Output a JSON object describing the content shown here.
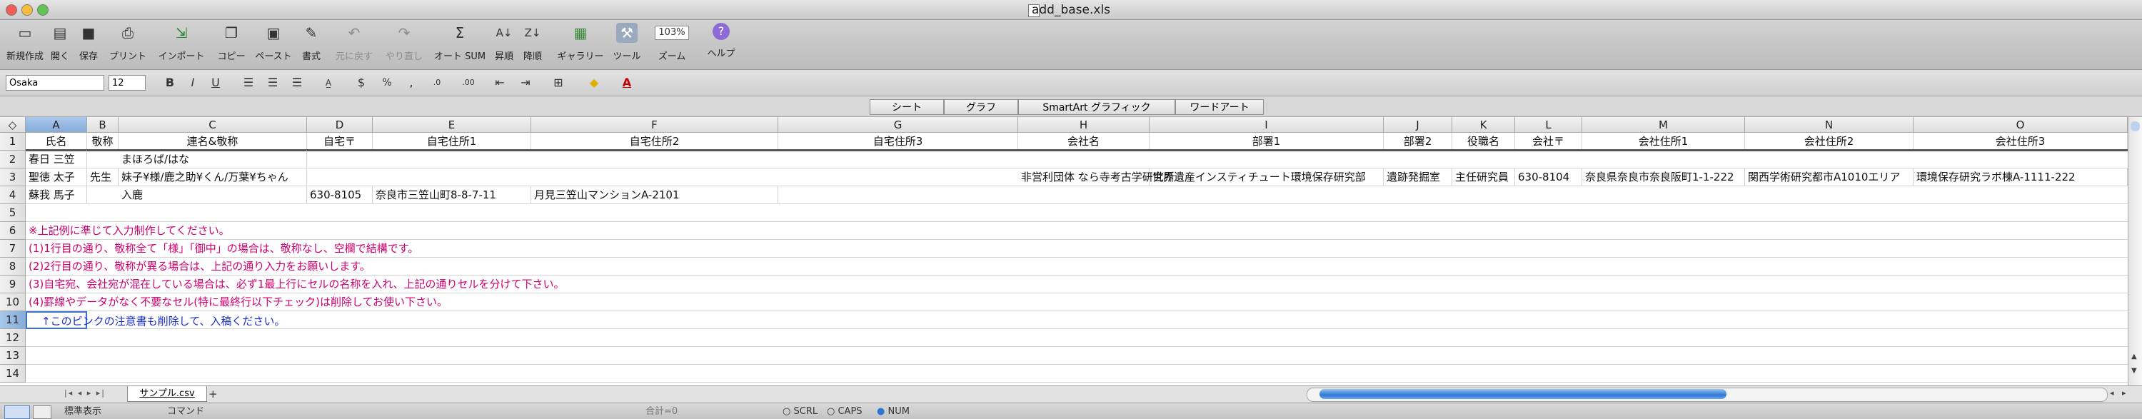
{
  "window": {
    "title": "add_base.xls"
  },
  "toolbar": {
    "new": "新規作成",
    "open": "開く",
    "save": "保存",
    "print": "プリント",
    "import": "インポート",
    "copy": "コピー",
    "paste": "ペースト",
    "format": "書式",
    "undo": "元に戻す",
    "redo": "やり直し",
    "autosum": "オート SUM",
    "sort_asc": "昇順",
    "sort_desc": "降順",
    "gallery": "ギャラリー",
    "toolbox": "ツール",
    "zoom_label": "ズーム",
    "zoom_value": "103%",
    "help": "ヘルプ"
  },
  "format_bar": {
    "font": "Osaka",
    "size": "12"
  },
  "ribbon": {
    "tabs": [
      "シート",
      "グラフ",
      "SmartArt グラフィック",
      "ワードアート"
    ]
  },
  "grid": {
    "columns": [
      "A",
      "B",
      "C",
      "D",
      "E",
      "F",
      "G",
      "H",
      "I",
      "J",
      "K",
      "L",
      "M",
      "N",
      "O"
    ],
    "rows": [
      "1",
      "2",
      "3",
      "4",
      "5",
      "6",
      "7",
      "8",
      "9",
      "10",
      "11",
      "12",
      "13",
      "14"
    ],
    "header_row": [
      "氏名",
      "敬称",
      "連名&敬称",
      "自宅〒",
      "自宅住所1",
      "自宅住所2",
      "自宅住所3",
      "会社名",
      "部署1",
      "部署2",
      "役職名",
      "会社〒",
      "会社住所1",
      "会社住所2",
      "会社住所3"
    ],
    "row2": {
      "A": "春日 三笠",
      "C": "まほろば/はな"
    },
    "row3": {
      "A": "聖徳 太子",
      "B": "先生",
      "C": "妹子¥様/鹿之助¥くん/万葉¥ちゃん",
      "H": "非営利団体 なら寺考古学研究所",
      "I": "世界遺産インスティチュート環境保存研究部",
      "J": "遺跡発掘室",
      "K": "主任研究員",
      "L": "630-8104",
      "M": "奈良県奈良市奈良阪町1-1-222",
      "N": "関西学術研究都市A1010エリア",
      "O": "環境保存研究ラボ棟A-1111-222"
    },
    "row4": {
      "A": "蘇我 馬子",
      "C": "入鹿",
      "D": "630-8105",
      "E": "奈良市三笠山町8-8-7-11",
      "F": "月見三笠山マンションA-2101"
    },
    "notes": [
      "※上記例に準じて入力制作してください。",
      "(1)1行目の通り、敬称全て「様」「御中」の場合は、敬称なし、空欄で結構です。",
      "(2)2行目の通り、敬称が異る場合は、上記の通り入力をお願いします。",
      "(3)自宅宛、会社宛が混在している場合は、必ず1最上行にセルの名称を入れ、上記の通りセルを分けて下さい。",
      "(4)罫線やデータがなく不要なセル(特に最終行以下チェック)は削除してお使い下さい。",
      "↑このピンクの注意書も削除して、入稿ください。"
    ]
  },
  "sheet_tabs": {
    "active": "サンプル.csv",
    "add": "+"
  },
  "status": {
    "view": "標準表示",
    "mode": "コマンド",
    "sum": "合計=0",
    "scrl": "SCRL",
    "caps": "CAPS",
    "num": "NUM"
  },
  "colors": {
    "note_pink": "#d0006f",
    "note_blue": "#1a2fd2",
    "selection": "#86acd9",
    "scroll_thumb": "#2d77d4"
  }
}
